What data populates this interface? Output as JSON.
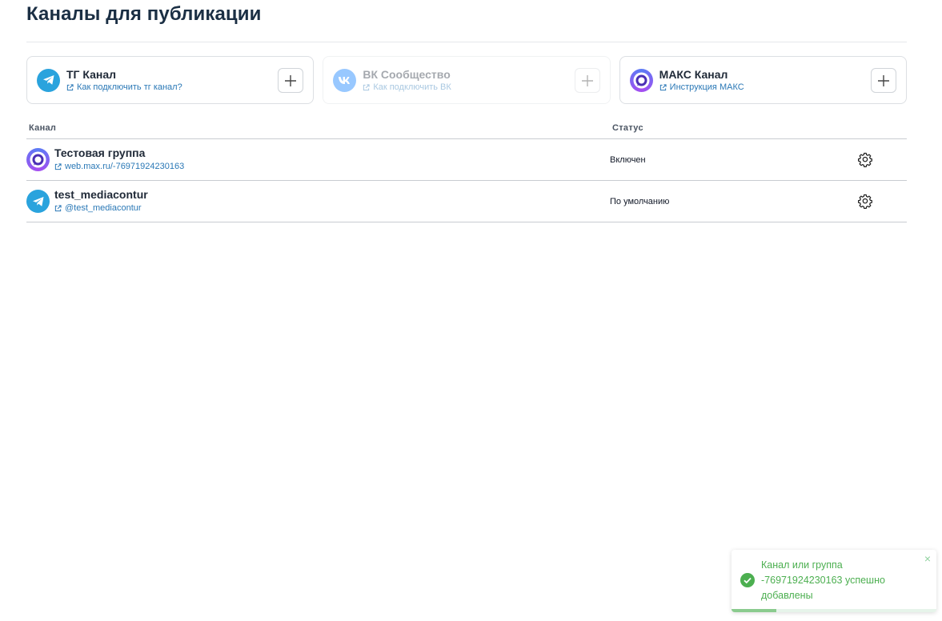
{
  "page": {
    "title": "Каналы для публикации"
  },
  "cards": [
    {
      "title": "ТГ Канал",
      "link": "Как подключить тг канал?",
      "icon": "telegram-icon",
      "disabled": false
    },
    {
      "title": "ВК Сообщество",
      "link": "Как подключить ВК",
      "icon": "vk-icon",
      "disabled": true
    },
    {
      "title": "МАКС Канал",
      "link": "Инструкция МАКС",
      "icon": "max-icon",
      "disabled": false
    }
  ],
  "table": {
    "headers": {
      "channel": "Канал",
      "status": "Статус"
    },
    "rows": [
      {
        "name": "Тестовая группа",
        "link": "web.max.ru/-76971924230163",
        "status": "Включен",
        "icon": "max-icon"
      },
      {
        "name": "test_mediacontur",
        "link": "@test_mediacontur",
        "status": "По умолчанию",
        "icon": "telegram-icon"
      }
    ]
  },
  "toast": {
    "message": "Канал или группа -76971924230163 успешно добавлены",
    "close": "×",
    "progress": 0.22
  },
  "colors": {
    "title": "#1b2f44",
    "link": "#2a78b6",
    "telegram": "#2aa3dd",
    "vk": "#0077ff",
    "success": "#4caf50"
  }
}
